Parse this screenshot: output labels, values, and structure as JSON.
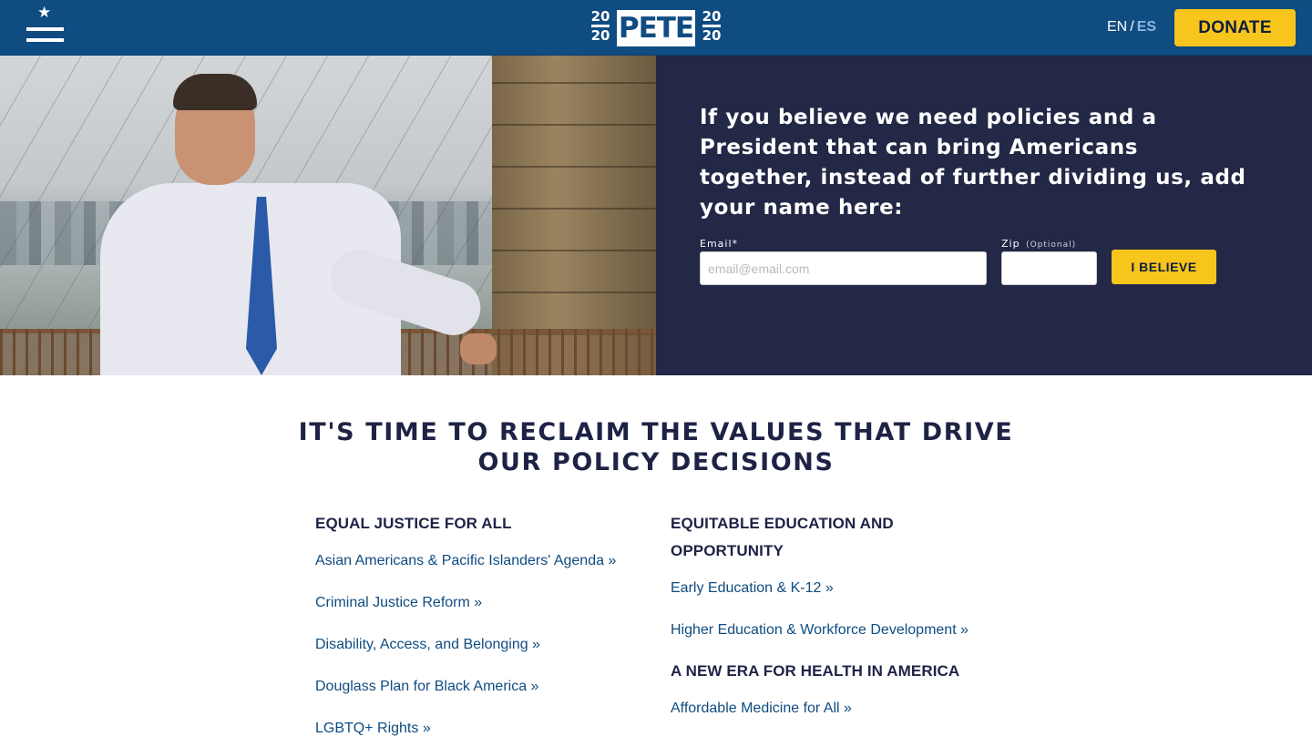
{
  "header": {
    "menu_icon": "hamburger-star-icon",
    "logo": {
      "year_top": "20",
      "year_bottom": "20",
      "name": "PETE"
    },
    "lang": {
      "en": "EN",
      "separator": "/",
      "es": "ES"
    },
    "donate_label": "DONATE",
    "colors": {
      "bar": "#0f4c81",
      "donate": "#f8c51c"
    }
  },
  "hero": {
    "pitch": "If you believe we need policies and a President that can bring Americans together, instead of further dividing us, add your name here:",
    "email_label": "Email*",
    "email_placeholder": "email@email.com",
    "zip_label": "Zip",
    "zip_optional": "(Optional)",
    "submit_label": "I BELIEVE",
    "colors": {
      "panel": "#222846"
    }
  },
  "policies": {
    "title": "IT'S TIME TO RECLAIM THE VALUES THAT DRIVE OUR POLICY DECISIONS",
    "left": {
      "heading": "EQUAL JUSTICE FOR ALL",
      "links": [
        "Asian Americans & Pacific Islanders' Agenda »",
        "Criminal Justice Reform »",
        "Disability, Access, and Belonging »",
        "Douglass Plan for Black America »",
        "LGBTQ+ Rights »"
      ]
    },
    "right": {
      "heading": "EQUITABLE EDUCATION AND OPPORTUNITY",
      "links": [
        "Early Education & K-12 »",
        "Higher Education & Workforce Development »"
      ],
      "heading2": "A NEW ERA FOR HEALTH IN AMERICA",
      "links2": [
        "Affordable Medicine for All »"
      ]
    }
  }
}
